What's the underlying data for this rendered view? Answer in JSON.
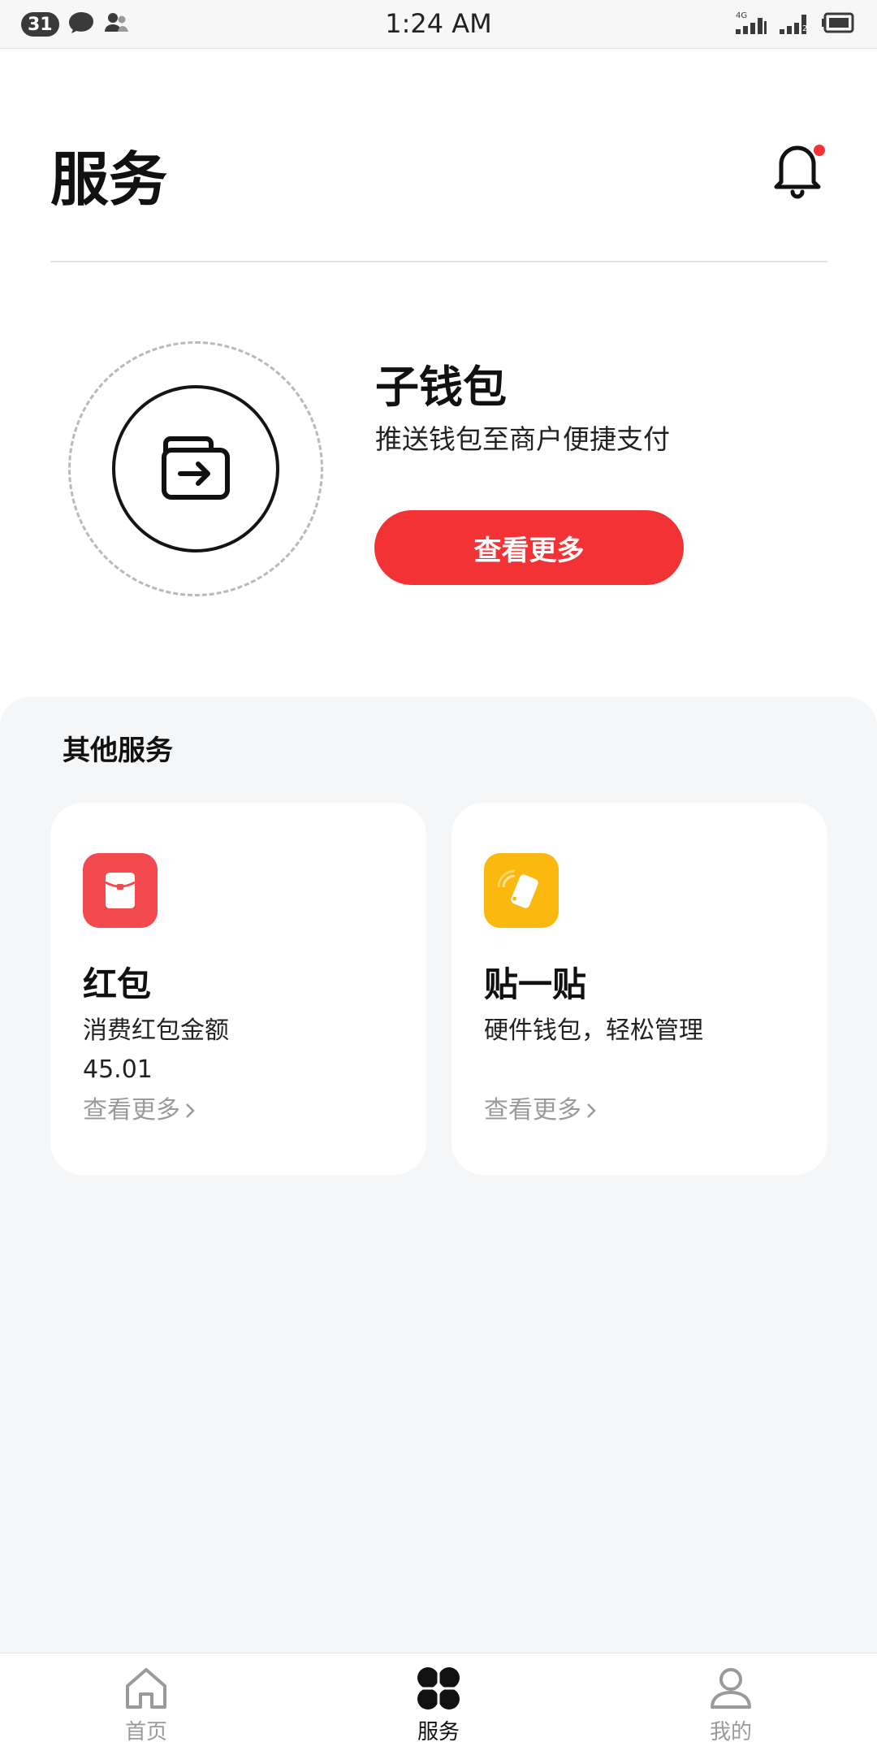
{
  "status_bar": {
    "notification_count": "31",
    "time": "1:24 AM",
    "network_label": "4G",
    "sim_label": "2"
  },
  "header": {
    "title": "服务"
  },
  "wallet": {
    "title": "子钱包",
    "subtitle": "推送钱包至商户便捷支付",
    "button_label": "查看更多"
  },
  "other_services": {
    "heading": "其他服务",
    "cards": [
      {
        "title": "红包",
        "description": "消费红包金额",
        "amount": "45.01",
        "more_label": "查看更多",
        "icon": "red-packet-icon",
        "icon_color": "#f24a4f"
      },
      {
        "title": "贴一贴",
        "description": "硬件钱包，轻松管理",
        "more_label": "查看更多",
        "icon": "nfc-phone-icon",
        "icon_color": "#fbb80f"
      }
    ]
  },
  "bottom_nav": {
    "items": [
      {
        "label": "首页",
        "icon": "home-icon",
        "active": false
      },
      {
        "label": "服务",
        "icon": "services-grid-icon",
        "active": true
      },
      {
        "label": "我的",
        "icon": "profile-icon",
        "active": false
      }
    ]
  },
  "colors": {
    "accent": "#f33236",
    "panel_background": "#f5f6f8",
    "active_nav": "#111111",
    "inactive_nav": "#9a9a9a",
    "notification_dot": "#f33236"
  }
}
